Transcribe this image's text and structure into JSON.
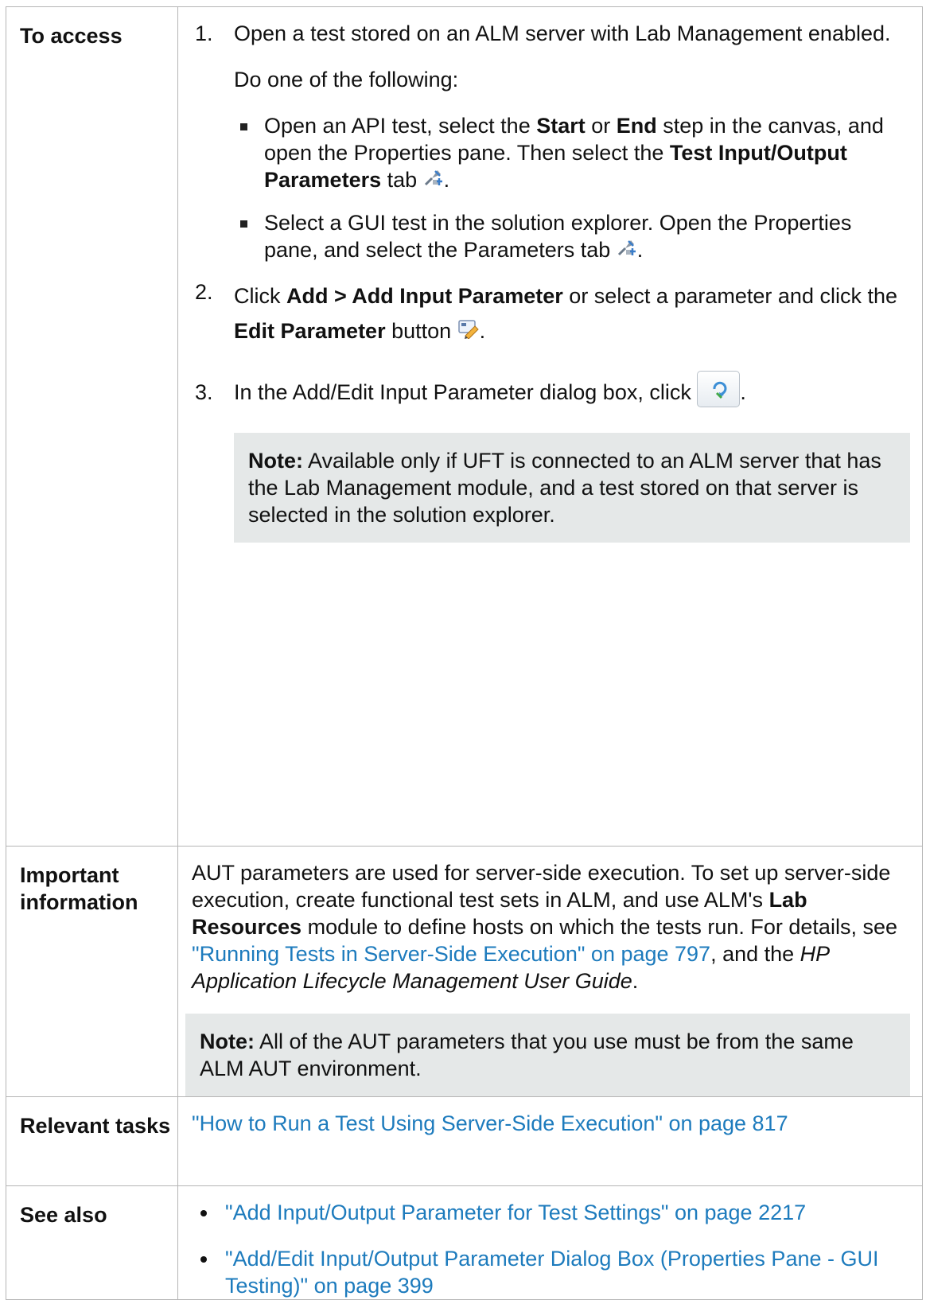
{
  "table": {
    "access": {
      "label": "To access",
      "step1": {
        "num": "1.",
        "text": "Open a test stored on an ALM server with Lab Management enabled.",
        "do_one": "Do one of the following:",
        "bullet1": {
          "t1": "Open an API test, select the ",
          "b1": "Start",
          "t2": " or ",
          "b2": "End",
          "t3": " step in the canvas, and open the Properties pane. Then select the ",
          "b3": "Test Input/Output Parameters",
          "t4": " tab ",
          "t5": "."
        },
        "bullet2": {
          "t1": "Select a GUI test in the solution explorer. Open the Properties pane, and select the Parameters tab ",
          "t2": "."
        }
      },
      "step2": {
        "num": "2.",
        "t1": "Click ",
        "b1": "Add > Add Input Parameter",
        "t2": " or select a parameter and click the ",
        "b2": "Edit Parameter",
        "t3": " button ",
        "t4": "."
      },
      "step3": {
        "num": "3.",
        "t1": "In the Add/Edit Input Parameter dialog box, click ",
        "t2": "."
      },
      "note": {
        "label": "Note:",
        "text": " Available only if UFT is connected to an ALM server that has the Lab Management module, and a test stored on that server is selected in the solution explorer."
      }
    },
    "important": {
      "label": "Important information",
      "t1": "AUT parameters are used for server-side execution. To set up server-side execution, create functional test sets in ALM, and use ALM's ",
      "b1": "Lab Resources",
      "t2": " module to define hosts on which the tests run. For details, see ",
      "link1": "\"Running Tests in Server-Side Execution\" on page 797",
      "t3": ", and the ",
      "i1": "HP Application Lifecycle Management User Guide",
      "t4": ".",
      "note": {
        "label": "Note:",
        "text": " All of the AUT parameters that you use must be from the same ALM AUT environment."
      }
    },
    "relevant": {
      "label": "Relevant tasks",
      "link": "\"How to Run a Test Using Server-Side Execution\" on page 817"
    },
    "see_also": {
      "label": "See also",
      "links": [
        "\"Add Input/Output Parameter for Test Settings\" on page 2217",
        "\"Add/Edit Input/Output Parameter Dialog Box (Properties Pane - GUI Testing)\" on page 399"
      ]
    }
  }
}
